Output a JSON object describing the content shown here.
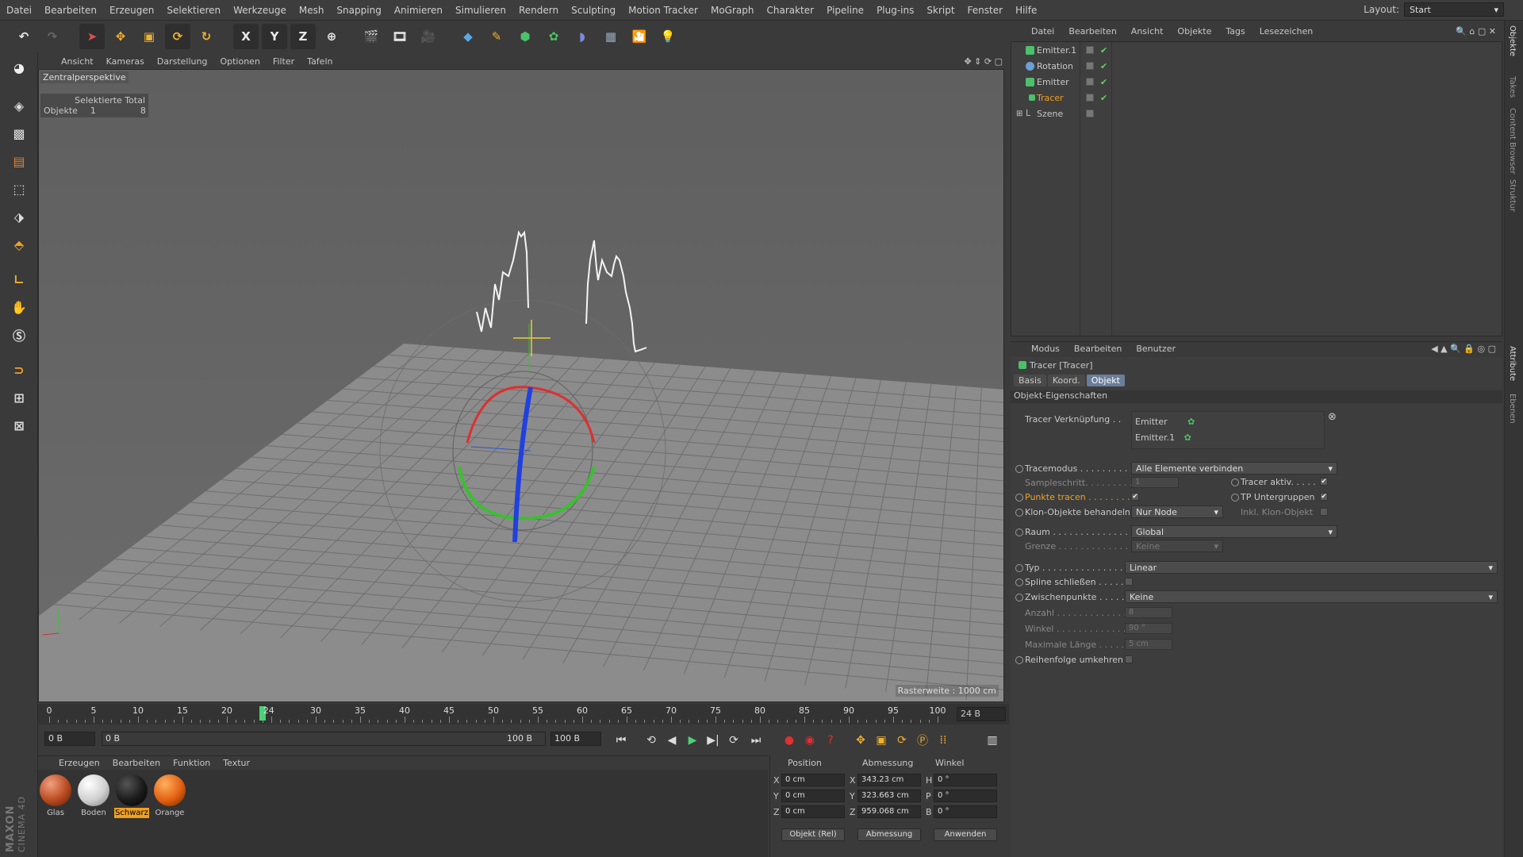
{
  "menubar": {
    "items": [
      "Datei",
      "Bearbeiten",
      "Erzeugen",
      "Selektieren",
      "Werkzeuge",
      "Mesh",
      "Snapping",
      "Animieren",
      "Simulieren",
      "Rendern",
      "Sculpting",
      "Motion Tracker",
      "MoGraph",
      "Charakter",
      "Pipeline",
      "Plug-ins",
      "Skript",
      "Fenster",
      "Hilfe"
    ],
    "layout_label": "Layout:",
    "layout_value": "Start"
  },
  "toolbar": {
    "axis_x": "X",
    "axis_y": "Y",
    "axis_z": "Z"
  },
  "viewport": {
    "menu": [
      "Ansicht",
      "Kameras",
      "Darstellung",
      "Optionen",
      "Filter",
      "Tafeln"
    ],
    "camera_label": "Zentralperspektive",
    "sel_header": "Selektierte Total",
    "sel_row_label": "Objekte",
    "sel_selected": "1",
    "sel_total": "8",
    "grid_label": "Rasterweite : 1000 cm"
  },
  "timeline": {
    "ticks": [
      "0",
      "5",
      "10",
      "15",
      "20",
      "24",
      "30",
      "35",
      "40",
      "45",
      "50",
      "55",
      "60",
      "65",
      "70",
      "75",
      "80",
      "85",
      "90",
      "95",
      "100"
    ],
    "current_frame": 24,
    "frame_box": "24 B"
  },
  "transport": {
    "start": "0 B",
    "range_start": "0 B",
    "range_end": "100 B",
    "end": "100 B"
  },
  "materials": {
    "menu": [
      "Erzeugen",
      "Bearbeiten",
      "Funktion",
      "Textur"
    ],
    "items": [
      {
        "name": "Glas",
        "color": "#b84a20"
      },
      {
        "name": "Boden",
        "color": "#d8d8d8"
      },
      {
        "name": "Schwarz",
        "color": "#1a1a1a"
      },
      {
        "name": "Orange",
        "color": "#e06010"
      }
    ]
  },
  "coords": {
    "headers": [
      "Position",
      "Abmessung",
      "Winkel"
    ],
    "rows": [
      {
        "axis": "X",
        "pos": "0 cm",
        "dim_axis": "X",
        "dim": "343.23 cm",
        "ang_axis": "H",
        "ang": "0 °"
      },
      {
        "axis": "Y",
        "pos": "0 cm",
        "dim_axis": "Y",
        "dim": "323.663 cm",
        "ang_axis": "P",
        "ang": "0 °"
      },
      {
        "axis": "Z",
        "pos": "0 cm",
        "dim_axis": "Z",
        "dim": "959.068 cm",
        "ang_axis": "B",
        "ang": "0 °"
      }
    ],
    "mode1": "Objekt (Rel)",
    "mode2": "Abmessung",
    "apply": "Anwenden"
  },
  "objects": {
    "menu": [
      "Datei",
      "Bearbeiten",
      "Ansicht",
      "Objekte",
      "Tags",
      "Lesezeichen"
    ],
    "items": [
      {
        "name": "Emitter.1",
        "color": "#4cc06a"
      },
      {
        "name": "Rotation",
        "color": "#6aa0d8"
      },
      {
        "name": "Emitter",
        "color": "#4cc06a"
      },
      {
        "name": "Tracer",
        "color": "#4cc06a",
        "highlight": true
      },
      {
        "name": "Szene",
        "color": "#bbbbbb"
      }
    ]
  },
  "attributes": {
    "menu": [
      "Modus",
      "Bearbeiten",
      "Benutzer"
    ],
    "title": "Tracer [Tracer]",
    "tabs": [
      "Basis",
      "Koord.",
      "Objekt"
    ],
    "section": "Objekt-Eigenschaften",
    "link_label": "Tracer Verknüpfung . .",
    "links": [
      "Emitter",
      "Emitter.1"
    ],
    "tracemodus_label": "Tracemodus . . . . . . . . . .",
    "tracemodus_value": "Alle Elemente verbinden",
    "sample_label": "Sampleschritt. . . . . . . . .",
    "sample_value": "1",
    "tracer_aktiv_label": "Tracer aktiv. . . . .",
    "punkte_label": "Punkte tracen . . . . . . . .",
    "tp_label": "TP Untergruppen",
    "klon_label": "Klon-Objekte behandeln",
    "klon_value": "Nur Node",
    "inkl_label": "Inkl. Klon-Objekt",
    "raum_label": "Raum . . . . . . . . . . . . . . .",
    "raum_value": "Global",
    "grenze_label": "Grenze . . . . . . . . . . . . .",
    "grenze_value": "Keine",
    "typ_label": "Typ . . . . . . . . . . . . . . .",
    "typ_value": "Linear",
    "spline_label": "Spline schließen . . . . . .",
    "zwischen_label": "Zwischenpunkte . . . . . .",
    "zwischen_value": "Keine",
    "anzahl_label": "Anzahl . . . . . . . . . . . . .",
    "anzahl_value": "8",
    "winkel_label": "Winkel . . . . . . . . . . . . .",
    "winkel_value": "90 °",
    "maxlaenge_label": "Maximale Länge . . . . . .",
    "maxlaenge_value": "5 cm",
    "reihen_label": "Reihenfolge umkehren"
  },
  "side_tabs": [
    "Objekte",
    "Takes",
    "Content Browser",
    "Struktur",
    "Attribute",
    "Ebenen"
  ]
}
